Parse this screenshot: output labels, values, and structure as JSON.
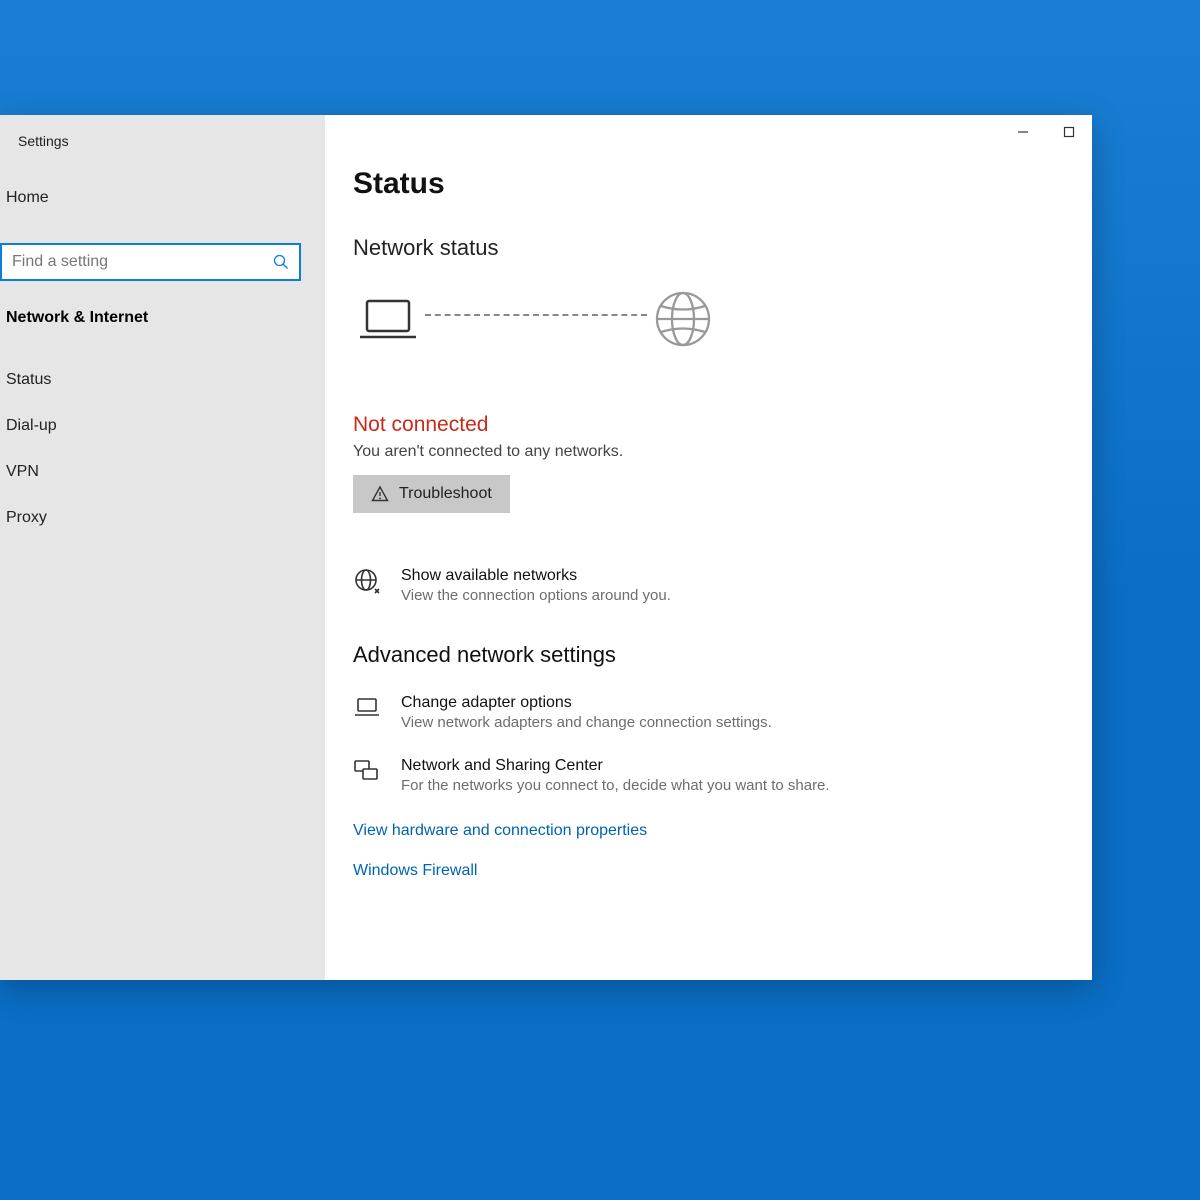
{
  "app_title": "Settings",
  "sidebar": {
    "home": "Home",
    "search_placeholder": "Find a setting",
    "category": "Network & Internet",
    "items": [
      {
        "label": "Status"
      },
      {
        "label": "Dial-up"
      },
      {
        "label": "VPN"
      },
      {
        "label": "Proxy"
      }
    ]
  },
  "main": {
    "page_title": "Status",
    "section_title": "Network status",
    "not_connected_title": "Not connected",
    "not_connected_sub": "You aren't connected to any networks.",
    "troubleshoot": "Troubleshoot",
    "available": {
      "title": "Show available networks",
      "sub": "View the connection options around you."
    },
    "advanced_title": "Advanced network settings",
    "adapter": {
      "title": "Change adapter options",
      "sub": "View network adapters and change connection settings."
    },
    "sharing": {
      "title": "Network and Sharing Center",
      "sub": "For the networks you connect to, decide what you want to share."
    },
    "link_hw": "View hardware and connection properties",
    "link_firewall": "Windows Firewall"
  }
}
